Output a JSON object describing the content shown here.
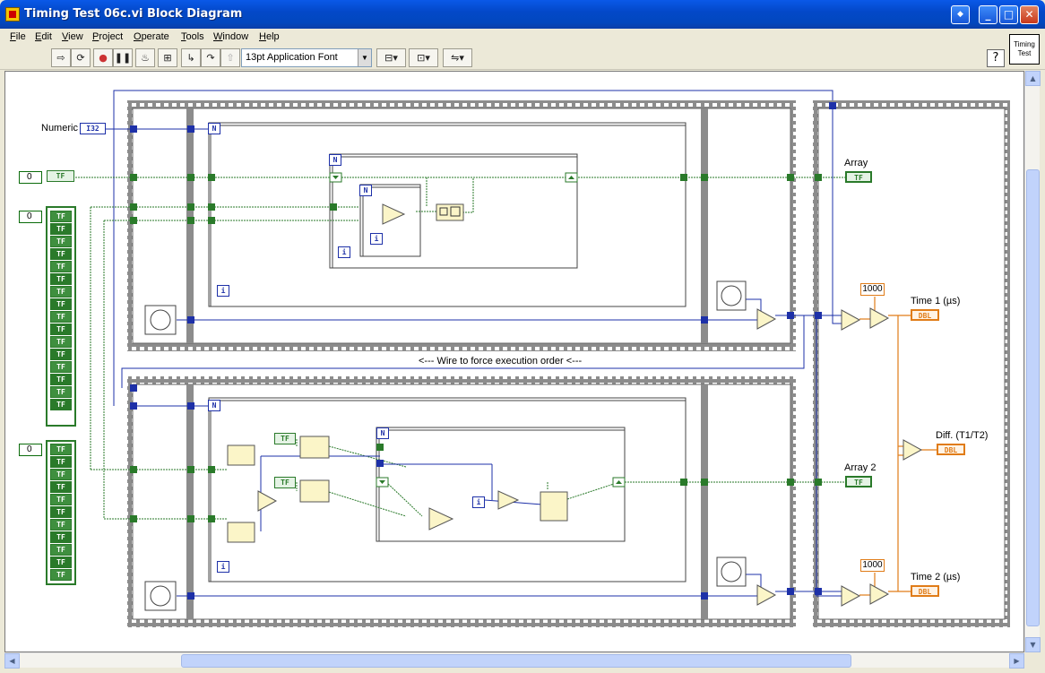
{
  "window": {
    "title": "Timing Test 06c.vi Block Diagram"
  },
  "menu": [
    "File",
    "Edit",
    "View",
    "Project",
    "Operate",
    "Tools",
    "Window",
    "Help"
  ],
  "toolbar": {
    "font": "13pt Application Font"
  },
  "vi_icon": {
    "line1": "Timing",
    "line2": "Test"
  },
  "diagram": {
    "numeric_label": "Numeric",
    "numeric_type": "I32",
    "zero_value": "0",
    "array_label": "Array",
    "array2_label": "Array 2",
    "tf_type": "TF",
    "const_1000": "1000",
    "time1_label": "Time 1 (µs)",
    "time2_label": "Time 2 (µs)",
    "diff_label": "Diff. (T1/T2)",
    "dbl_type": "DBL",
    "wire_note": "<---   Wire to force execution order   <---",
    "loop_count": "N",
    "loop_iter": "i"
  },
  "colors": {
    "boolean_wire": "#2a7a2a",
    "integer_wire": "#1d30a8",
    "double_wire": "#e07c18",
    "frame": "#8c8c8c"
  }
}
